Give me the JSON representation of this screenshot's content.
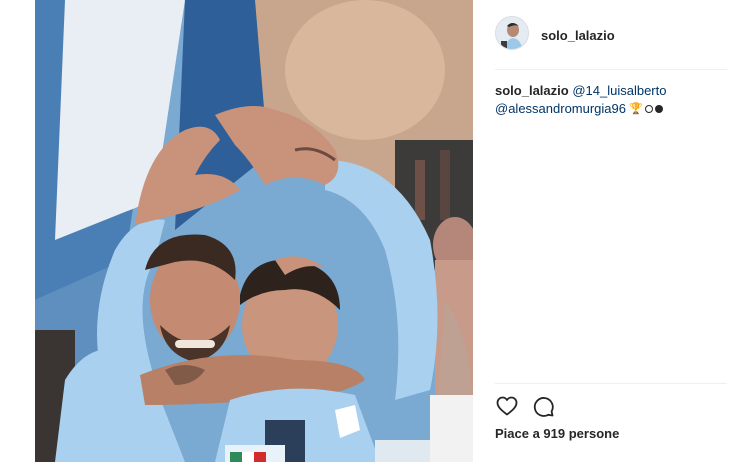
{
  "post": {
    "username": "solo_lalazio",
    "caption": {
      "username": "solo_lalazio",
      "mention1": "@14_luisalberto",
      "mention2": "@alessandromurgia96",
      "trophy": "🏆"
    },
    "likes": {
      "text": "Piace a 919 persone"
    }
  },
  "colors": {
    "mention": "#003569",
    "text": "#262626",
    "divider": "#efefef",
    "jersey": "#a9d0ef",
    "banner": "#6a9fc8"
  },
  "icons": {
    "like": "heart-outline-icon",
    "comment": "speech-bubble-icon"
  }
}
